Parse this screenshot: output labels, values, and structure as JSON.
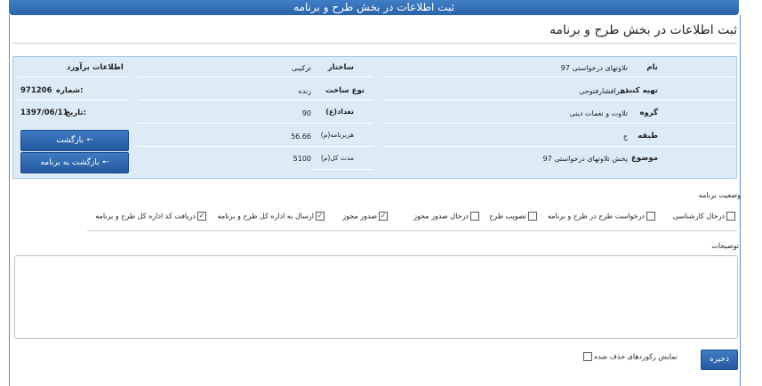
{
  "header": {
    "bar_title": "ثبت اطلاعات در بخش طرح و برنامه",
    "page_title": "ثبت اطلاعات در بخش طرح و برنامه"
  },
  "info": {
    "name_label": "نام",
    "name_value": "تلاوتهای درخواستی 97",
    "producer_label": "تهیه کننده",
    "producer_value": "امیرافشارفتوحی",
    "group_label": "گروه",
    "group_value": "تلاوت و نغمات دینی",
    "class_label": "طبقه",
    "class_value": "ج",
    "subject_label": "موضوع",
    "subject_value": "پخش تلاوتهای درخواستی 97",
    "structure_label": "ساختار",
    "structure_value": "ترکیبی",
    "build_type_label": "نوع ساخت",
    "build_type_value": "زنده",
    "count_label": "تعداد(ع)",
    "count_value": "90",
    "per_program_label": "هربرنامه(م)",
    "per_program_value": "56.66",
    "total_duration_label": "مدت کل(م)",
    "total_duration_value": "5100",
    "estimate_label": "اطلاعات برآورد",
    "number_label": "شماره:",
    "number_value": "971206",
    "date_label": "تاریخ:",
    "date_value": "1397/06/11"
  },
  "buttons": {
    "back": "بازگشت",
    "back_to_program": "بازگشت به برنامه",
    "save": "ذخیره"
  },
  "status": {
    "title": "وضعیت برنامه",
    "items": [
      {
        "label": "درحال کارشناسی",
        "checked": ""
      },
      {
        "label": "درخواست طرح در طرح و برنامه",
        "checked": ""
      },
      {
        "label": "تصویب طرح",
        "checked": ""
      },
      {
        "label": "درحال صدور مجوز",
        "checked": ""
      },
      {
        "label": "صدور مجوز",
        "checked": "✓"
      },
      {
        "label": "ارسال به اداره کل طرح و برنامه",
        "checked": "✓"
      },
      {
        "label": "دریافت کد اداره کل طرح و برنامه",
        "checked": "✓"
      }
    ]
  },
  "description": {
    "title": "توضیحات",
    "value": ""
  },
  "show_deleted": {
    "label": "نمایش رکوردهای حذف شده",
    "checked": ""
  }
}
